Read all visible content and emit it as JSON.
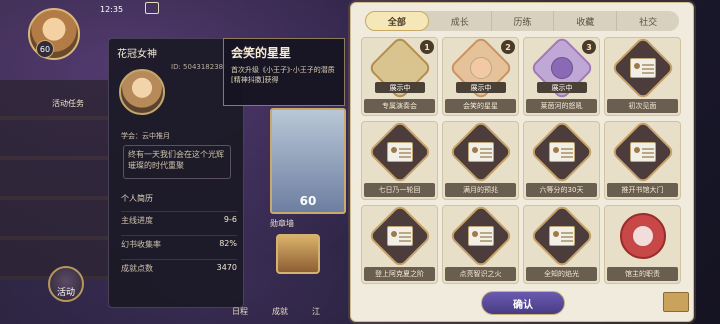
{
  "status_bar": {
    "time": "12:35"
  },
  "player": {
    "level": "60",
    "name": "花冠女神",
    "uid": "ID: 5043182385",
    "school": "学会：云中推月",
    "motto": "终有一天我们会在这个光辉璀璨的时代重聚"
  },
  "left_ui": {
    "activity_label": "活动任务",
    "event_button": "活动"
  },
  "profile_stats": {
    "section_title": "个人简历",
    "rows": [
      {
        "label": "主线进度",
        "value": "9-6"
      },
      {
        "label": "幻书收集率",
        "value": "82%"
      },
      {
        "label": "成就点数",
        "value": "3470"
      }
    ]
  },
  "tooltip": {
    "title": "会笑的星星",
    "description": "首次升级《小王子》·小王子的潜质[精神抖擞]获得"
  },
  "middle": {
    "card_number": "60",
    "badge_wall": "勋章墙",
    "bottom_tabs": [
      "日程",
      "成就",
      "江"
    ]
  },
  "achievements": {
    "tabs": [
      "全部",
      "成长",
      "历练",
      "收藏",
      "社交"
    ],
    "active_tab": 0,
    "items": [
      {
        "name": "专属演奏会",
        "status": "展示中",
        "rank": "1",
        "style": "gold",
        "glyph": "gift"
      },
      {
        "name": "会笑的星星",
        "status": "展示中",
        "rank": "2",
        "style": "orange",
        "glyph": "star"
      },
      {
        "name": "莱茵河的怒吼",
        "status": "展示中",
        "rank": "3",
        "style": "purple",
        "glyph": "star2"
      },
      {
        "name": "初次见面",
        "status": "",
        "rank": "",
        "style": "dark",
        "glyph": "card"
      },
      {
        "name": "七日乃一轮回",
        "status": "",
        "rank": "",
        "style": "dark",
        "glyph": "card"
      },
      {
        "name": "满月的预兆",
        "status": "",
        "rank": "",
        "style": "dark",
        "glyph": "card"
      },
      {
        "name": "六等分的30天",
        "status": "",
        "rank": "",
        "style": "dark",
        "glyph": "card"
      },
      {
        "name": "推开书馆大门",
        "status": "",
        "rank": "",
        "style": "dark",
        "glyph": "card"
      },
      {
        "name": "登上阿克夏之阶",
        "status": "",
        "rank": "",
        "style": "dark",
        "glyph": "card"
      },
      {
        "name": "点亮智识之火",
        "status": "",
        "rank": "",
        "style": "dark",
        "glyph": "card"
      },
      {
        "name": "全知的焰光",
        "status": "",
        "rank": "",
        "style": "dark",
        "glyph": "card"
      },
      {
        "name": "馆主的职责",
        "status": "",
        "rank": "",
        "style": "red",
        "glyph": "seal"
      }
    ],
    "confirm_label": "确认"
  }
}
